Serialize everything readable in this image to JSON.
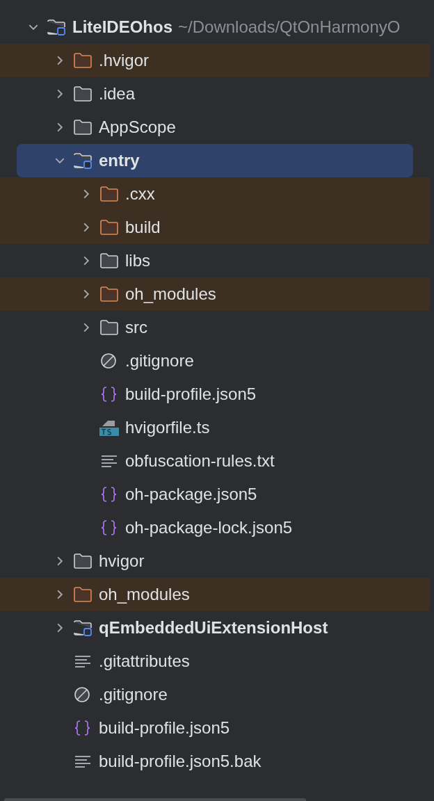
{
  "tree": [
    {
      "name": "LiteIDEOhos",
      "path": "~/Downloads/QtOnHarmonyO",
      "kind": "module",
      "expanded": true,
      "excluded": false,
      "selected": false,
      "children": [
        {
          "name": ".hvigor",
          "kind": "folder",
          "expanded": false,
          "excluded": true,
          "selected": false
        },
        {
          "name": ".idea",
          "kind": "folder",
          "expanded": false,
          "excluded": false,
          "selected": false
        },
        {
          "name": "AppScope",
          "kind": "folder",
          "expanded": false,
          "excluded": false,
          "selected": false
        },
        {
          "name": "entry",
          "kind": "module",
          "expanded": true,
          "excluded": false,
          "selected": true,
          "children": [
            {
              "name": ".cxx",
              "kind": "folder",
              "expanded": false,
              "excluded": true,
              "selected": false
            },
            {
              "name": "build",
              "kind": "folder",
              "expanded": false,
              "excluded": true,
              "selected": false
            },
            {
              "name": "libs",
              "kind": "folder",
              "expanded": false,
              "excluded": false,
              "selected": false
            },
            {
              "name": "oh_modules",
              "kind": "folder",
              "expanded": false,
              "excluded": true,
              "selected": false
            },
            {
              "name": "src",
              "kind": "folder",
              "expanded": false,
              "excluded": false,
              "selected": false
            },
            {
              "name": ".gitignore",
              "kind": "ignore",
              "selected": false
            },
            {
              "name": "build-profile.json5",
              "kind": "json",
              "selected": false
            },
            {
              "name": "hvigorfile.ts",
              "kind": "ts",
              "selected": false
            },
            {
              "name": "obfuscation-rules.txt",
              "kind": "text",
              "selected": false
            },
            {
              "name": "oh-package.json5",
              "kind": "json",
              "selected": false
            },
            {
              "name": "oh-package-lock.json5",
              "kind": "json",
              "selected": false
            }
          ]
        },
        {
          "name": "hvigor",
          "kind": "folder",
          "expanded": false,
          "excluded": false,
          "selected": false
        },
        {
          "name": "oh_modules",
          "kind": "folder",
          "expanded": false,
          "excluded": true,
          "selected": false
        },
        {
          "name": "qEmbeddedUiExtensionHost",
          "kind": "module",
          "expanded": false,
          "excluded": false,
          "selected": false
        },
        {
          "name": ".gitattributes",
          "kind": "text",
          "selected": false
        },
        {
          "name": ".gitignore",
          "kind": "ignore",
          "selected": false
        },
        {
          "name": "build-profile.json5",
          "kind": "json",
          "selected": false
        },
        {
          "name": "build-profile.json5.bak",
          "kind": "text",
          "selected": false
        }
      ]
    }
  ]
}
